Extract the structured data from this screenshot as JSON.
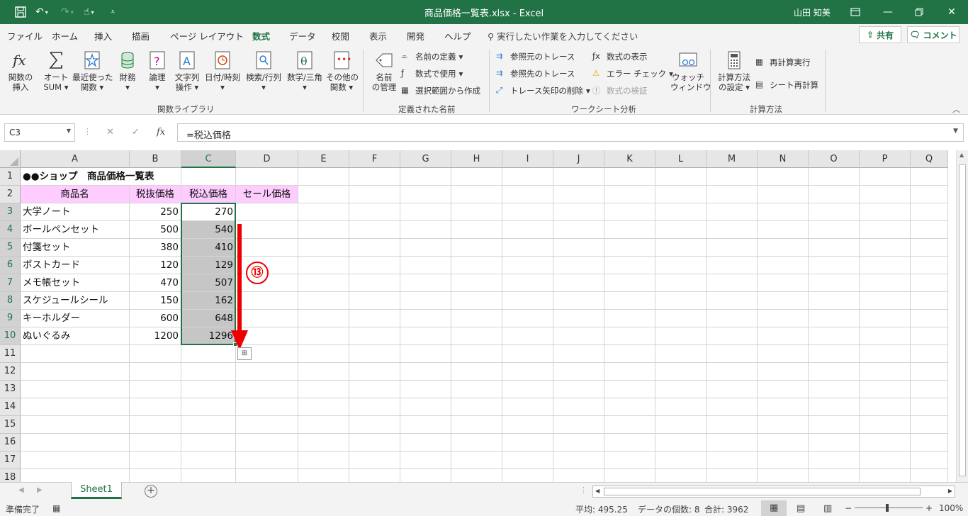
{
  "titlebar": {
    "title": "商品価格一覧表.xlsx  -  Excel",
    "user": "山田 知美",
    "bg_color": "#217346"
  },
  "menu": {
    "tabs": [
      "ファイル",
      "ホーム",
      "挿入",
      "描画",
      "ページ レイアウト",
      "数式",
      "データ",
      "校閲",
      "表示",
      "開発",
      "ヘルプ"
    ],
    "active": "数式",
    "tellme": "実行したい作業を入力してください",
    "share": "共有",
    "comment": "コメント"
  },
  "ribbon": {
    "function_library": {
      "insert_function": [
        "関数の",
        "挿入"
      ],
      "autosum": [
        "オート",
        "SUM"
      ],
      "recent": [
        "最近使った",
        "関数"
      ],
      "financial": "財務",
      "logical": "論理",
      "text": [
        "文字列",
        "操作"
      ],
      "datetime": "日付/時刻",
      "lookup": "検索/行列",
      "math": "数学/三角",
      "more": [
        "その他の",
        "関数"
      ],
      "group_label": "関数ライブラリ"
    },
    "defined_names": {
      "name_manager": [
        "名前",
        "の管理"
      ],
      "define_name": "名前の定義",
      "use_in_formula": "数式で使用",
      "create_from_selection": "選択範囲から作成",
      "group_label": "定義された名前"
    },
    "formula_auditing": {
      "trace_precedents": "参照元のトレース",
      "trace_dependents": "参照先のトレース",
      "remove_arrows": "トレース矢印の削除",
      "show_formulas": "数式の表示",
      "error_checking": "エラー チェック",
      "evaluate_formula": "数式の検証",
      "watch_window": [
        "ウォッチ",
        "ウィンドウ"
      ],
      "group_label": "ワークシート分析"
    },
    "calculation": {
      "calc_options": [
        "計算方法",
        "の設定"
      ],
      "calc_now": "再計算実行",
      "calc_sheet": "シート再計算",
      "group_label": "計算方法"
    }
  },
  "formula_bar": {
    "name_box": "C3",
    "formula": "=税込価格"
  },
  "grid": {
    "columns": [
      "A",
      "B",
      "C",
      "D",
      "E",
      "F",
      "G",
      "H",
      "I",
      "J",
      "K",
      "L",
      "M",
      "N",
      "O",
      "P",
      "Q"
    ],
    "rows": [
      "1",
      "2",
      "3",
      "4",
      "5",
      "6",
      "7",
      "8",
      "9",
      "10",
      "11",
      "12",
      "13",
      "14",
      "15",
      "16",
      "17",
      "18"
    ],
    "title": "●●ショップ　商品価格一覧表",
    "headers": [
      "商品名",
      "税抜価格",
      "税込価格",
      "セール価格"
    ],
    "products": [
      {
        "name": "大学ノート",
        "price": "250",
        "tax_price": "270"
      },
      {
        "name": "ボールペンセット",
        "price": "500",
        "tax_price": "540"
      },
      {
        "name": "付箋セット",
        "price": "380",
        "tax_price": "410"
      },
      {
        "name": "ポストカード",
        "price": "120",
        "tax_price": "129"
      },
      {
        "name": "メモ帳セット",
        "price": "470",
        "tax_price": "507"
      },
      {
        "name": "スケジュールシール",
        "price": "150",
        "tax_price": "162"
      },
      {
        "name": "キーホルダー",
        "price": "600",
        "tax_price": "648"
      },
      {
        "name": "ぬいぐるみ",
        "price": "1200",
        "tax_price": "1296"
      }
    ],
    "step_badge": "⑬",
    "header_fill": "#ffccff",
    "selection_fill": "#c6c6c6"
  },
  "sheets": {
    "tab": "Sheet1",
    "add": "+"
  },
  "status": {
    "ready": "準備完了",
    "average": "平均: 495.25",
    "count": "データの個数: 8",
    "sum": "合計: 3962",
    "zoom": "100%"
  }
}
